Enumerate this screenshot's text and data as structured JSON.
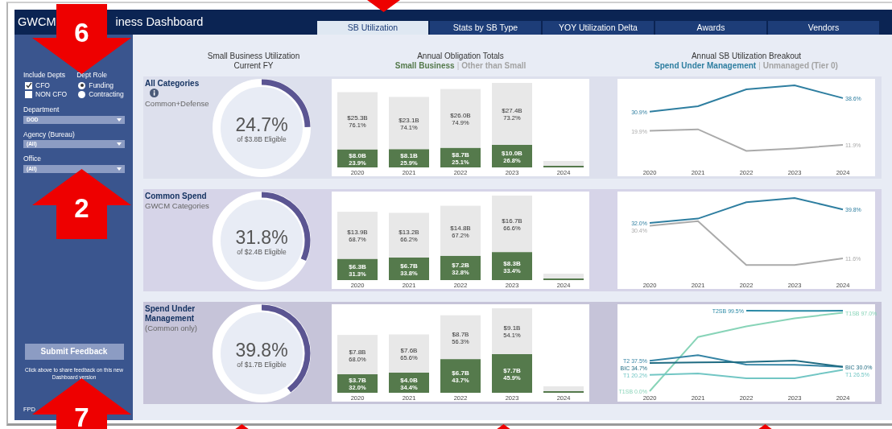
{
  "header": {
    "title_parts": [
      "GWCM",
      "iness Dashboard"
    ]
  },
  "tabs": [
    {
      "label": "SB Utilization",
      "selected": true
    },
    {
      "label": "Stats by SB Type",
      "selected": false
    },
    {
      "label": "YOY Utilization Delta",
      "selected": false
    },
    {
      "label": "Awards",
      "selected": false
    },
    {
      "label": "Vendors",
      "selected": false
    }
  ],
  "filters": {
    "include_depts": {
      "label": "Include Depts",
      "options": [
        {
          "label": "CFO",
          "checked": true
        },
        {
          "label": "NON CFO",
          "checked": false
        }
      ]
    },
    "dept_role": {
      "label": "Dept Role",
      "options": [
        {
          "label": "Funding",
          "selected": true
        },
        {
          "label": "Contracting",
          "selected": false
        }
      ]
    },
    "dropdowns": [
      {
        "label": "Department",
        "value": "DOD"
      },
      {
        "label": "Agency (Bureau)",
        "value": "(All)"
      },
      {
        "label": "Office",
        "value": "(All)"
      }
    ]
  },
  "feedback": {
    "button": "Submit Feedback",
    "note": "Click above to share feedback on this new Dashboard version"
  },
  "footer_fragment": "FPD",
  "column_headers": [
    {
      "title": "Small Business Utilization",
      "subtitle": "Current FY"
    },
    {
      "title": "Annual Obligation Totals",
      "separator": "|",
      "legend": [
        {
          "label": "Small Business",
          "color": "#557a4c"
        },
        {
          "label": "Other than Small",
          "color": "#a3a3a3"
        }
      ]
    },
    {
      "title": "Annual SB Utilization Breakout",
      "separator": "|",
      "legend": [
        {
          "label": "Spend Under Management",
          "color": "#2e7ea0"
        },
        {
          "label": "Unmanaged (Tier 0)",
          "color": "#a3a3a3"
        }
      ]
    }
  ],
  "rows": [
    {
      "title": "All Categories",
      "info": true,
      "subtitle": "Common+Defense",
      "utilization": {
        "value": "24.7%",
        "caption": "of $3.8B Eligible"
      },
      "obligations": {
        "chart_data": {
          "type": "bar",
          "stacked": true,
          "categories": [
            "2020",
            "2021",
            "2022",
            "2023",
            "2024"
          ],
          "series": [
            {
              "color": "#557a4c",
              "values": [
                8.0,
                8.1,
                8.7,
                10.0,
                null
              ],
              "value_labels": [
                "$8.0B",
                "$8.1B",
                "$8.7B",
                "$10.0B",
                null
              ]
            },
            {
              "color": "#e8e8e8",
              "values": [
                25.3,
                23.1,
                26.0,
                27.4,
                null
              ],
              "value_labels": [
                "$25.3B",
                "$23.1B",
                "$26.0B",
                "$27.4B",
                null
              ]
            }
          ]
        },
        "share_labels": [
          {
            "kind": "upper",
            "labels": [
              "76.1%",
              "74.1%",
              "74.9%",
              "73.2%"
            ]
          },
          {
            "kind": "lower",
            "labels": [
              "23.9%",
              "25.9%",
              "25.1%",
              "26.8%"
            ]
          }
        ]
      },
      "breakout": {
        "chart_data": {
          "type": "line",
          "categories": [
            "2020",
            "2021",
            "2022",
            "2023",
            "2024"
          ],
          "series": [
            {
              "color": "#2e7ea0",
              "values": [
                30.9,
                34.0,
                43.6,
                45.9,
                38.6
              ],
              "value_labels": [
                "30.9%",
                null,
                null,
                null,
                "38.6%"
              ]
            },
            {
              "color": "#aaaaaa",
              "values": [
                19.9,
                20.8,
                8.5,
                9.9,
                11.9
              ],
              "value_labels": [
                "19.9%",
                null,
                null,
                null,
                "11.9%"
              ]
            }
          ]
        }
      }
    },
    {
      "title": "Common Spend",
      "subtitle": "GWCM Categories",
      "utilization": {
        "value": "31.8%",
        "caption": "of $2.4B Eligible"
      },
      "obligations": {
        "chart_data": {
          "type": "bar",
          "stacked": true,
          "categories": [
            "2020",
            "2021",
            "2022",
            "2023",
            "2024"
          ],
          "series": [
            {
              "color": "#557a4c",
              "values": [
                6.3,
                6.7,
                7.2,
                8.3,
                null
              ],
              "value_labels": [
                "$6.3B",
                "$6.7B",
                "$7.2B",
                "$8.3B",
                null
              ]
            },
            {
              "color": "#e8e8e8",
              "values": [
                13.9,
                13.2,
                14.8,
                16.7,
                null
              ],
              "value_labels": [
                "$13.9B",
                "$13.2B",
                "$14.8B",
                "$16.7B",
                null
              ]
            }
          ]
        },
        "share_labels": [
          {
            "kind": "upper",
            "labels": [
              "68.7%",
              "66.2%",
              "67.2%",
              "66.6%"
            ]
          },
          {
            "kind": "lower",
            "labels": [
              "31.3%",
              "33.8%",
              "32.8%",
              "33.4%"
            ]
          }
        ]
      },
      "breakout": {
        "chart_data": {
          "type": "line",
          "categories": [
            "2020",
            "2021",
            "2022",
            "2023",
            "2024"
          ],
          "series": [
            {
              "color": "#2e7ea0",
              "values": [
                32.0,
                34.5,
                44.0,
                46.4,
                39.8
              ],
              "value_labels": [
                "32.0%",
                null,
                null,
                null,
                "39.8%"
              ]
            },
            {
              "color": "#aaaaaa",
              "values": [
                30.4,
                33.1,
                7.8,
                7.8,
                11.6
              ],
              "value_labels": [
                "30.4%",
                null,
                null,
                null,
                "11.6%"
              ]
            }
          ]
        }
      }
    },
    {
      "title": "Spend Under Management",
      "subtitle": "(Common only)",
      "utilization": {
        "value": "39.8%",
        "caption": "of $1.7B Eligible"
      },
      "obligations": {
        "chart_data": {
          "type": "bar",
          "stacked": true,
          "categories": [
            "2020",
            "2021",
            "2022",
            "2023",
            "2024"
          ],
          "series": [
            {
              "color": "#557a4c",
              "values": [
                3.7,
                4.0,
                6.7,
                7.7,
                null
              ],
              "value_labels": [
                "$3.7B",
                "$4.0B",
                "$6.7B",
                "$7.7B",
                null
              ]
            },
            {
              "color": "#e8e8e8",
              "values": [
                7.8,
                7.6,
                8.7,
                9.1,
                null
              ],
              "value_labels": [
                "$7.8B",
                "$7.6B",
                "$8.7B",
                "$9.1B",
                null
              ]
            }
          ]
        },
        "share_labels": [
          {
            "kind": "upper",
            "labels": [
              "68.0%",
              "65.6%",
              "56.3%",
              "54.1%"
            ]
          },
          {
            "kind": "lower",
            "labels": [
              "32.0%",
              "34.4%",
              "43.7%",
              "45.9%"
            ]
          }
        ]
      },
      "breakout": {
        "chart_data": {
          "type": "line",
          "categories": [
            "2020",
            "2021",
            "2022",
            "2023",
            "2024"
          ],
          "series": [
            {
              "color": "#2b8aa6",
              "values": [
                null,
                null,
                99.5,
                99.2,
                99.5
              ],
              "value_labels": [
                null,
                null,
                "T2SB 99.5%",
                null,
                null
              ]
            },
            {
              "color": "#88d4b8",
              "values": [
                0.0,
                67,
                80,
                90,
                97.0
              ],
              "value_labels": [
                "T1SB 0.0%",
                null,
                null,
                null,
                "T1SB 97.0%"
              ]
            },
            {
              "color": "#3584a4",
              "values": [
                37.5,
                44.5,
                32.7,
                32.5,
                30.0
              ],
              "value_labels": [
                "T2 37.5%",
                null,
                null,
                null,
                null
              ]
            },
            {
              "color": "#1f6b82",
              "values": [
                34.7,
                35.6,
                36.0,
                37.8,
                30.0
              ],
              "value_labels": [
                "BIC 34.7%",
                null,
                null,
                null,
                "BIC 30.0%"
              ]
            },
            {
              "color": "#72c6c4",
              "values": [
                20.2,
                21.8,
                16.0,
                16.0,
                26.5
              ],
              "value_labels": [
                "T1 20.2%",
                null,
                null,
                null,
                "T1 26.5%"
              ]
            }
          ]
        }
      }
    }
  ],
  "annotations": [
    {
      "kind": "arrow_down",
      "label": "6"
    },
    {
      "kind": "arrow_up",
      "label": "2"
    },
    {
      "kind": "arrow_up",
      "label": "7"
    },
    {
      "kind": "arrow_down"
    },
    {
      "kind": "arrow_up"
    },
    {
      "kind": "arrow_up"
    },
    {
      "kind": "arrow_up"
    }
  ]
}
